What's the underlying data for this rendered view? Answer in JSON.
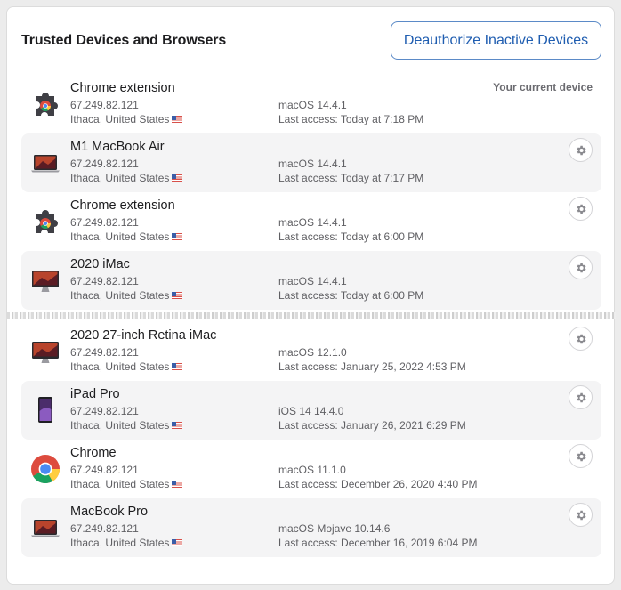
{
  "header": {
    "title": "Trusted Devices and Browsers",
    "deauthorize_label": "Deauthorize Inactive Devices"
  },
  "current_device_label": "Your current device",
  "devices": [
    {
      "name": "Chrome extension",
      "ip": "67.249.82.121",
      "location": "Ithaca, United States",
      "os": "macOS 14.4.1",
      "access": "Last access: Today at 7:18 PM",
      "icon": "chrome-extension-icon"
    },
    {
      "name": "M1 MacBook Air",
      "ip": "67.249.82.121",
      "location": "Ithaca, United States",
      "os": "macOS 14.4.1",
      "access": "Last access: Today at 7:17 PM",
      "icon": "laptop-icon"
    },
    {
      "name": "Chrome extension",
      "ip": "67.249.82.121",
      "location": "Ithaca, United States",
      "os": "macOS 14.4.1",
      "access": "Last access: Today at 6:00 PM",
      "icon": "chrome-extension-icon"
    },
    {
      "name": "2020 iMac",
      "ip": "67.249.82.121",
      "location": "Ithaca, United States",
      "os": "macOS 14.4.1",
      "access": "Last access: Today at 6:00 PM",
      "icon": "imac-icon"
    },
    {
      "name": "2020 27-inch Retina iMac",
      "ip": "67.249.82.121",
      "location": "Ithaca, United States",
      "os": "macOS 12.1.0",
      "access": "Last access: January 25, 2022 4:53 PM",
      "icon": "imac-icon"
    },
    {
      "name": "iPad Pro",
      "ip": "67.249.82.121",
      "location": "Ithaca, United States",
      "os": "iOS 14 14.4.0",
      "access": "Last access: January 26, 2021 6:29 PM",
      "icon": "ipad-icon"
    },
    {
      "name": "Chrome",
      "ip": "67.249.82.121",
      "location": "Ithaca, United States",
      "os": "macOS 11.1.0",
      "access": "Last access: December 26, 2020 4:40 PM",
      "icon": "chrome-icon"
    },
    {
      "name": "MacBook Pro",
      "ip": "67.249.82.121",
      "location": "Ithaca, United States",
      "os": "macOS Mojave 10.14.6",
      "access": "Last access: December 16, 2019 6:04 PM",
      "icon": "laptop-icon"
    }
  ],
  "colors": {
    "accent": "#1f5db0",
    "row_shade": "#f4f4f5"
  }
}
